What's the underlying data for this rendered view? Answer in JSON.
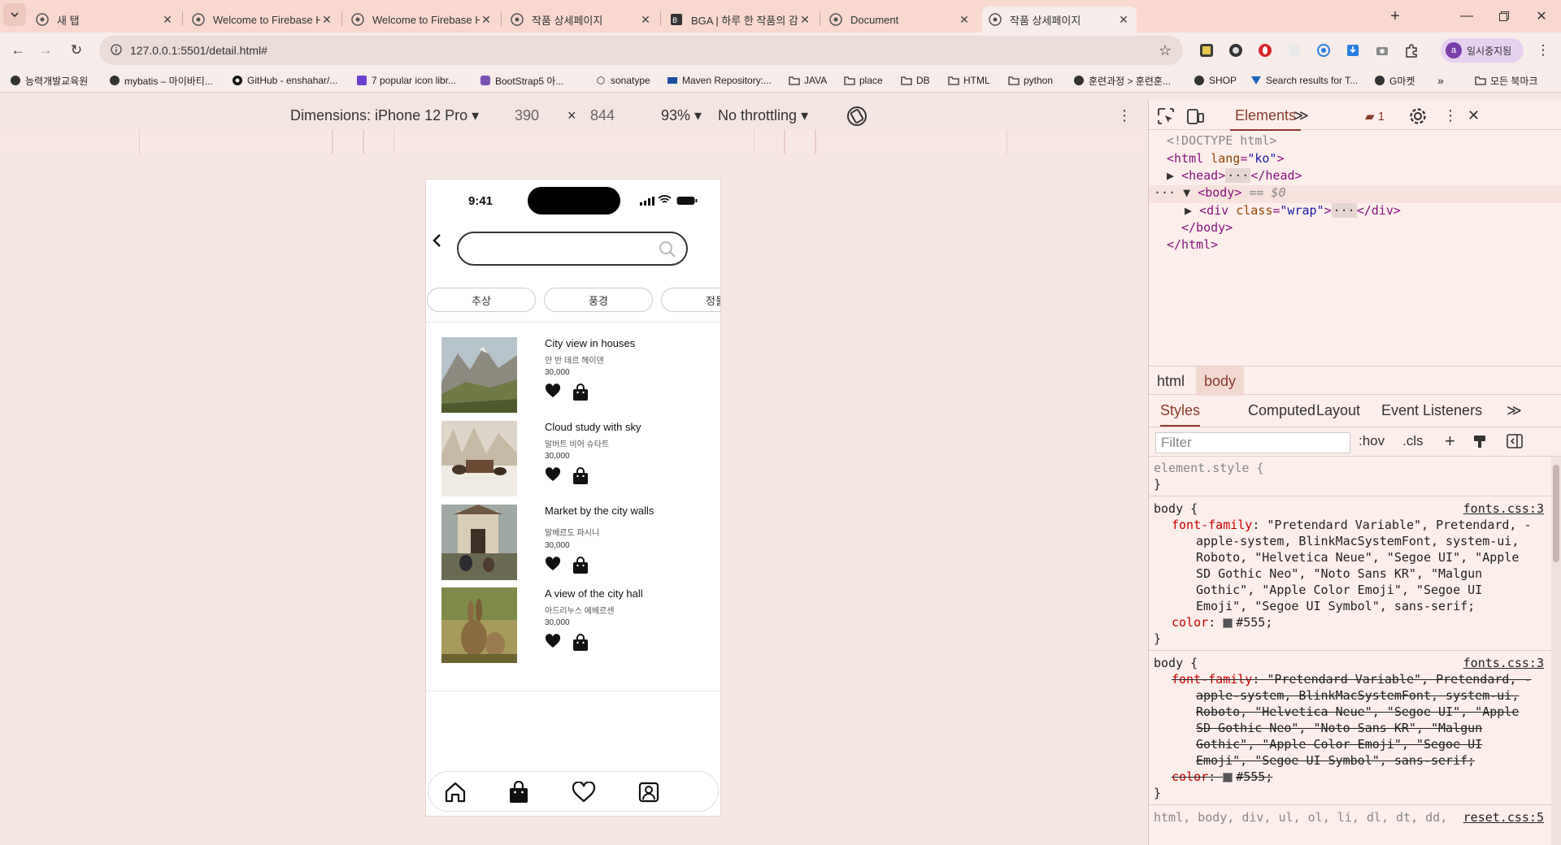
{
  "browser": {
    "tabs": [
      {
        "title": "새 탭",
        "icon": "chrome-icon"
      },
      {
        "title": "Welcome to Firebase Hosting",
        "icon": "globe-icon"
      },
      {
        "title": "Welcome to Firebase Hosting",
        "icon": "globe-icon"
      },
      {
        "title": "작품 상세페이지",
        "icon": "globe-icon"
      },
      {
        "title": "BGA | 하루 한 작품의 감상부터",
        "icon": "bga-icon"
      },
      {
        "title": "Document",
        "icon": "globe-icon"
      },
      {
        "title": "작품 상세페이지",
        "icon": "globe-icon",
        "active": true
      }
    ],
    "url": "127.0.0.1:5501/detail.html#",
    "profile_label": "일시중지됨",
    "profile_initial": "a",
    "bookmarks": [
      "능력개발교육원",
      "mybatis – 마이바티...",
      "GitHub - enshahar/...",
      "7 popular icon libr...",
      "BootStrap5 아...",
      "sonatype",
      "Maven Repository:...",
      "JAVA",
      "place",
      "DB",
      "HTML",
      "python",
      "훈련과정 > 훈련훈...",
      "SHOP",
      "Search results for T...",
      "G마켓"
    ],
    "bookmarks_more": "»",
    "all_bookmarks": "모든 북마크"
  },
  "device_toolbar": {
    "dimensions": "Dimensions: iPhone 12 Pro",
    "width": "390",
    "times": "×",
    "height": "844",
    "zoom": "93%",
    "throttling": "No throttling"
  },
  "phone": {
    "time": "9:41",
    "categories": [
      "추상",
      "풍경",
      "정물"
    ],
    "items": [
      {
        "title": "City view in houses",
        "artist": "얀 반 데르 헤이덴",
        "price": "30,000"
      },
      {
        "title": "Cloud study with sky",
        "artist": "알버트 비어 슈타트",
        "price": "30,000"
      },
      {
        "title": "Market by the city walls",
        "artist": "알베르도 파시니",
        "price": "30,000"
      },
      {
        "title": "A view of the city hall",
        "artist": "아드리누스 에베르센",
        "price": "30,000"
      }
    ]
  },
  "devtools": {
    "panel": "Elements",
    "issues_count": "1",
    "dom": {
      "doctype": "<!DOCTYPE html>",
      "html_open": "<html",
      "lang_attr": "lang",
      "lang_val": "\"ko\"",
      "head": "<head>",
      "head_close": "</head>",
      "body_open": "<body>",
      "body_ref": "== $0",
      "div_open": "<div",
      "class_attr": "class",
      "class_val": "\"wrap\"",
      "div_close": "</div>",
      "body_close": "</body>",
      "html_close": "</html>"
    },
    "crumbs": [
      "html",
      "body"
    ],
    "style_tabs": [
      "Styles",
      "Computed",
      "Layout",
      "Event Listeners"
    ],
    "filter_placeholder": "Filter",
    "hov": ":hov",
    "cls": ".cls",
    "rules": {
      "element_style": "element.style {",
      "close": "}",
      "body_sel": "body {",
      "source1": "fonts.css:3",
      "ff_prop": "font-family",
      "ff_lines": [
        "\"Pretendard Variable\", Pretendard, -",
        "apple-system, BlinkMacSystemFont, system-ui,",
        "Roboto, \"Helvetica Neue\", \"Segoe UI\", \"Apple",
        "SD Gothic Neo\", \"Noto Sans KR\", \"Malgun",
        "Gothic\", \"Apple Color Emoji\", \"Segoe UI",
        "Emoji\", \"Segoe UI Symbol\", sans-serif;"
      ],
      "color_prop": "color",
      "color_val": "#555;",
      "source2": "fonts.css:3",
      "reset_sel": "html, body, div, ul, ol, li, dl, dt, dd,",
      "reset_src": "reset.css:5"
    }
  }
}
